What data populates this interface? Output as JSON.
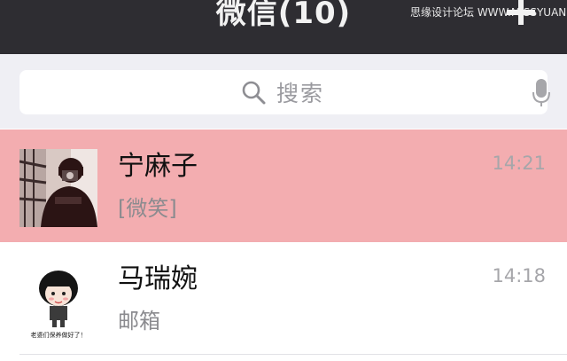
{
  "navbar": {
    "title": "微信(10)",
    "watermark": "思缘设计论坛 WWW.MISSYUAN.COM",
    "add_icon": "plus-icon"
  },
  "search": {
    "placeholder": "搜索",
    "icon": "search-icon",
    "voice_icon": "microphone-icon"
  },
  "chats": [
    {
      "name": "宁麻子",
      "preview": "[微笑]",
      "time": "14:21",
      "highlighted": true,
      "avatar": "photo-avatar-person-with-camera"
    },
    {
      "name": "马瑞婉",
      "preview": "邮箱",
      "time": "14:18",
      "highlighted": false,
      "avatar": "cartoon-girl-avatar",
      "avatar_caption": "老婆们保养做好了！"
    }
  ],
  "colors": {
    "navbar_bg": "#2e2d32",
    "search_bg": "#efeff4",
    "highlight_row": "#f3adb0",
    "text_secondary": "#8b8b8f"
  }
}
